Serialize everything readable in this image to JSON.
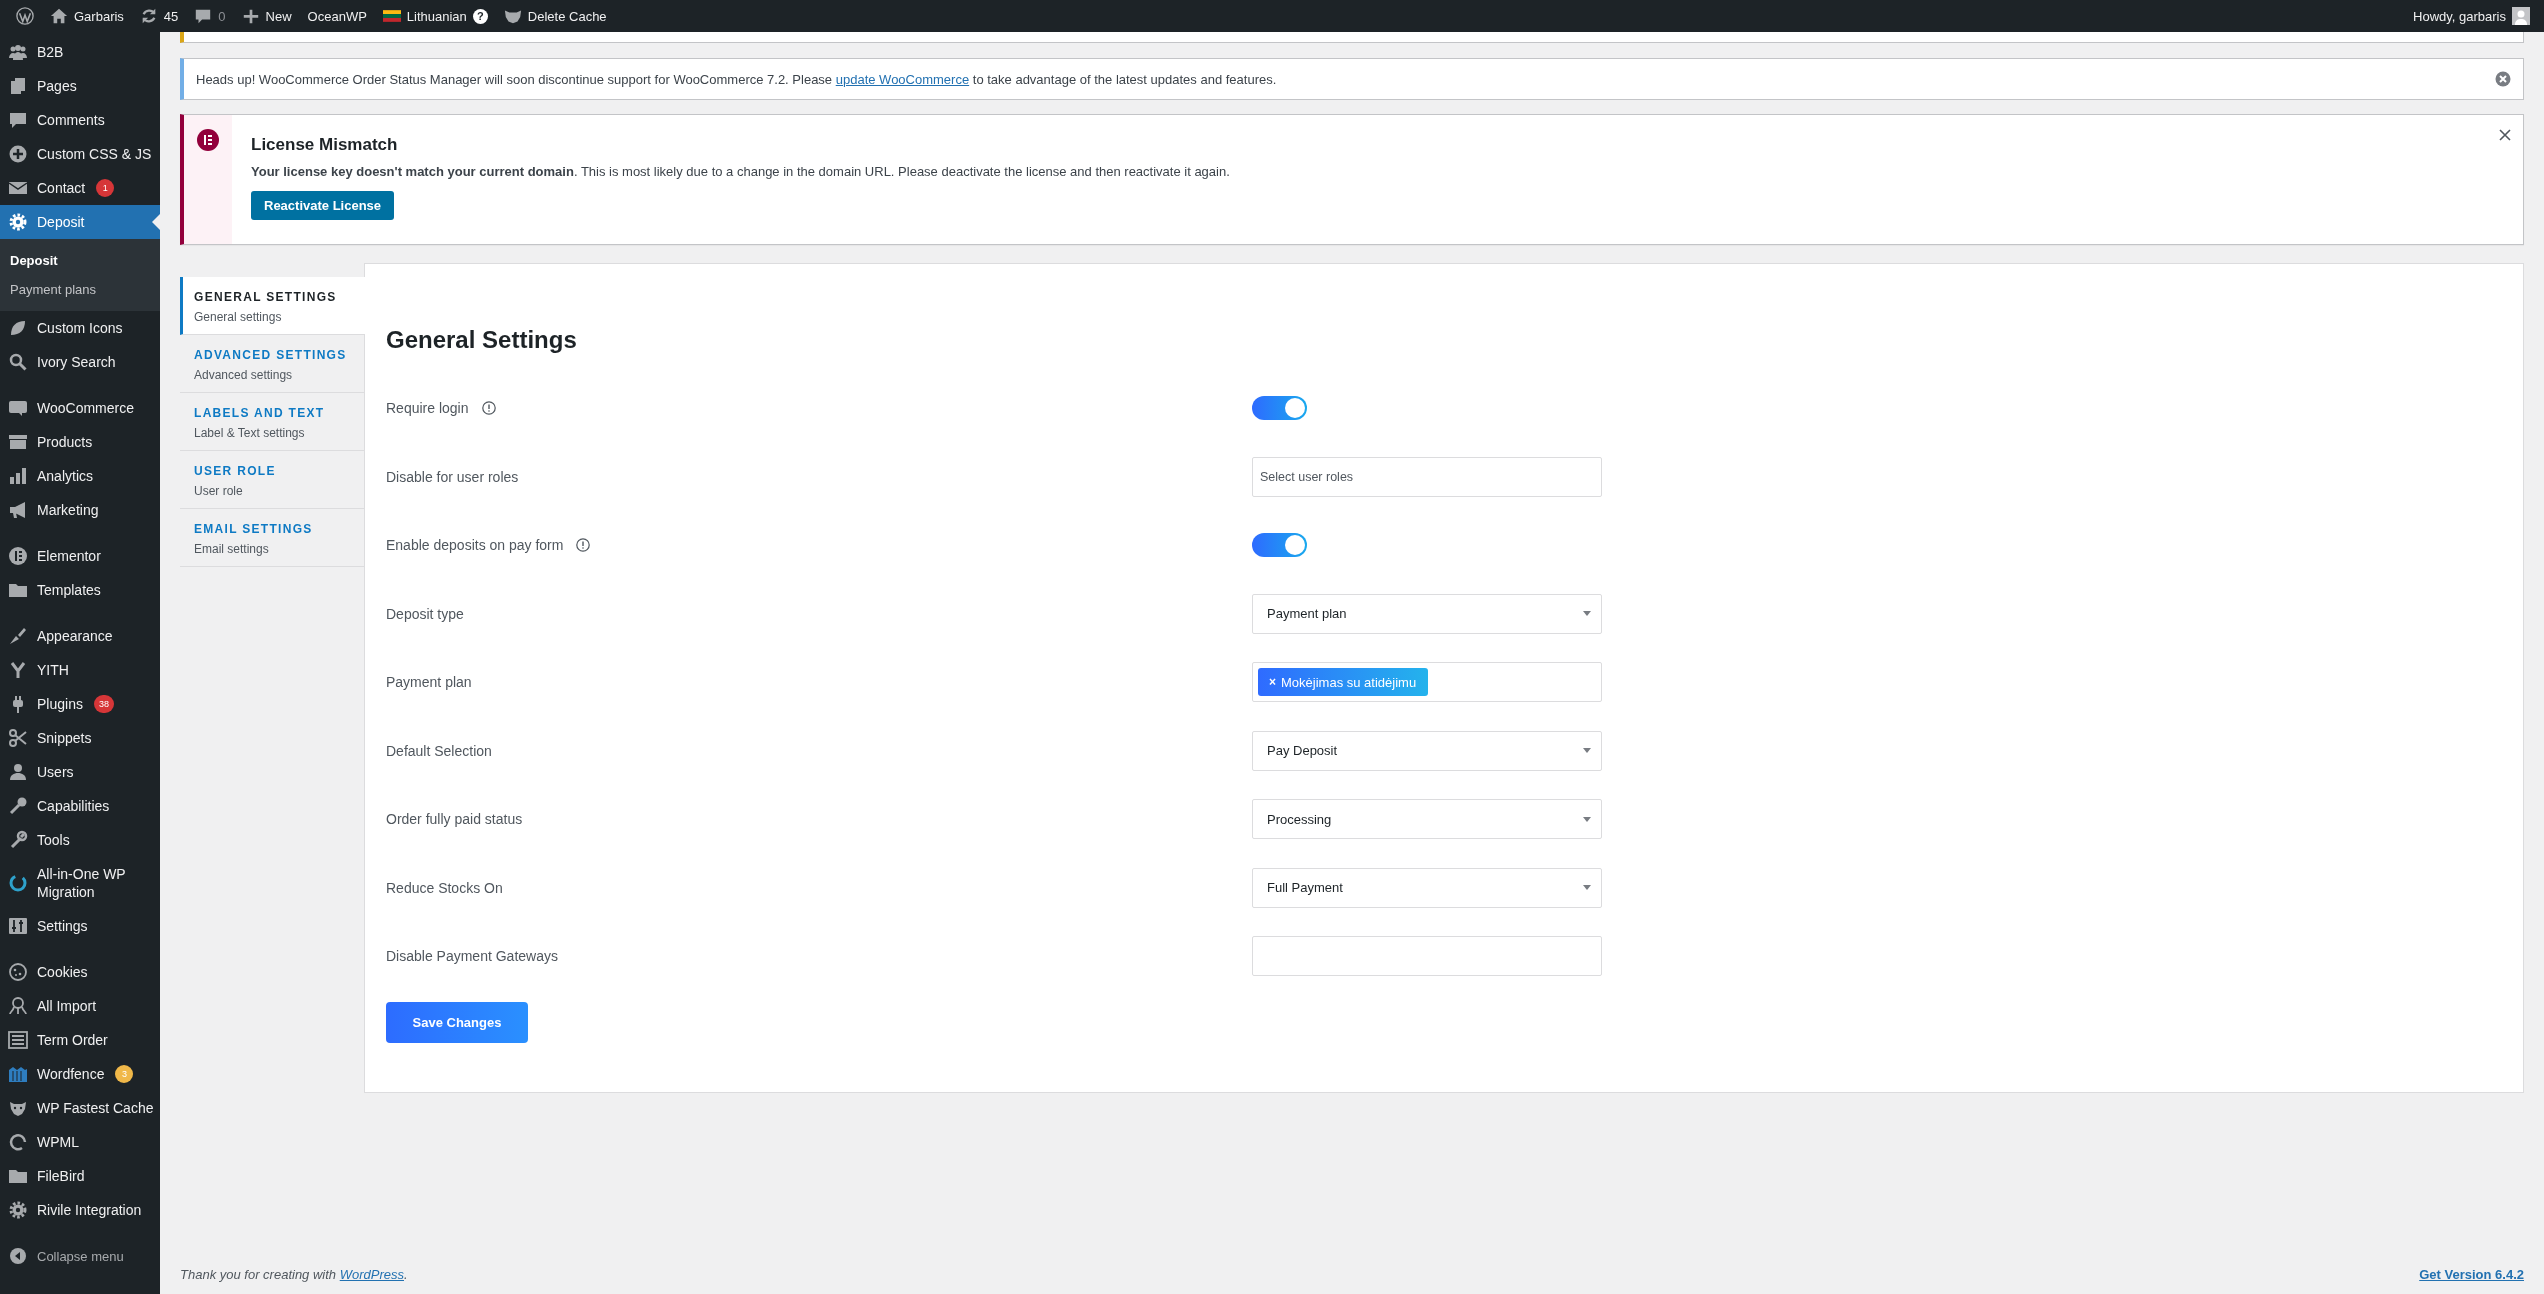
{
  "admin_bar": {
    "site": "Garbaris",
    "updates": "45",
    "comments": "0",
    "new": "New",
    "theme": "OceanWP",
    "language": "Lithuanian",
    "language_help": "?",
    "cache": "Delete Cache",
    "greeting": "Howdy, garbaris"
  },
  "sidebar": {
    "sections": [
      {
        "items": [
          {
            "label": "B2B",
            "selected": false
          },
          {
            "label": "Pages",
            "selected": false
          },
          {
            "label": "Comments",
            "selected": false
          },
          {
            "label": "Custom CSS & JS",
            "selected": false
          },
          {
            "label": "Contact",
            "selected": false,
            "badge": {
              "text": "1",
              "color": "#d63638"
            }
          },
          {
            "label": "Deposit",
            "selected": true,
            "submenu": [
              {
                "label": "Deposit",
                "selected": true
              },
              {
                "label": "Payment plans",
                "selected": false
              }
            ]
          },
          {
            "label": "Custom Icons",
            "selected": false
          },
          {
            "label": "Ivory Search",
            "selected": false
          }
        ]
      },
      {
        "items": [
          {
            "label": "WooCommerce",
            "selected": false
          },
          {
            "label": "Products",
            "selected": false
          },
          {
            "label": "Analytics",
            "selected": false
          },
          {
            "label": "Marketing",
            "selected": false
          }
        ]
      },
      {
        "items": [
          {
            "label": "Elementor",
            "selected": false
          },
          {
            "label": "Templates",
            "selected": false
          }
        ]
      },
      {
        "items": [
          {
            "label": "Appearance",
            "selected": false
          },
          {
            "label": "YITH",
            "selected": false
          },
          {
            "label": "Plugins",
            "selected": false,
            "badge": {
              "text": "38",
              "color": "#d63638"
            }
          },
          {
            "label": "Snippets",
            "selected": false
          },
          {
            "label": "Users",
            "selected": false
          },
          {
            "label": "Capabilities",
            "selected": false
          },
          {
            "label": "Tools",
            "selected": false
          },
          {
            "label": "All-in-One WP Migration",
            "selected": false
          },
          {
            "label": "Settings",
            "selected": false
          }
        ]
      },
      {
        "items": [
          {
            "label": "Cookies",
            "selected": false
          },
          {
            "label": "All Import",
            "selected": false
          },
          {
            "label": "Term Order",
            "selected": false
          },
          {
            "label": "Wordfence",
            "selected": false,
            "badge": {
              "text": "3",
              "color": "#f0b849"
            }
          },
          {
            "label": "WP Fastest Cache",
            "selected": false
          },
          {
            "label": "WPML",
            "selected": false
          },
          {
            "label": "FileBird",
            "selected": false
          },
          {
            "label": "Rivile Integration",
            "selected": false
          }
        ]
      }
    ],
    "collapse": "Collapse menu"
  },
  "notices": [
    {
      "kind": "info",
      "text_before": "Heads up! WooCommerce Order Status Manager will soon discontinue support for WooCommerce 7.2. Please ",
      "link": "update WooCommerce",
      "text_after": " to take advantage of the latest updates and features."
    },
    {
      "kind": "license",
      "title": "License Mismatch",
      "text": "**Your license key doesn't match your current domain**. This is most likely due to a change in the domain URL. Please deactivate the license and then reactivate it again.",
      "button": "Reactivate License"
    }
  ],
  "settings": {
    "tabs": [
      {
        "title": "GENERAL SETTINGS",
        "subtitle": "General settings",
        "selected": true
      },
      {
        "title": "ADVANCED SETTINGS",
        "subtitle": "Advanced settings",
        "selected": false
      },
      {
        "title": "LABELS AND TEXT",
        "subtitle": "Label & Text settings",
        "selected": false
      },
      {
        "title": "USER ROLE",
        "subtitle": "User role",
        "selected": false
      },
      {
        "title": "EMAIL SETTINGS",
        "subtitle": "Email settings",
        "selected": false
      }
    ],
    "heading": "General Settings",
    "fields": [
      {
        "label": "Require login",
        "help": true,
        "kind": "toggle",
        "on": true
      },
      {
        "label": "Disable for user roles",
        "help": false,
        "kind": "multiselect",
        "placeholder": "Select user roles"
      },
      {
        "label": "Enable deposits on pay form",
        "help": true,
        "kind": "toggle",
        "on": true
      },
      {
        "label": "Deposit type",
        "help": false,
        "kind": "select",
        "value": "Payment plan"
      },
      {
        "label": "Payment plan",
        "help": false,
        "kind": "tags",
        "tags": [
          {
            "remove": "×",
            "label": "Mokėjimas su atidėjimu"
          }
        ]
      },
      {
        "label": "Default Selection",
        "help": false,
        "kind": "select",
        "value": "Pay Deposit"
      },
      {
        "label": "Order fully paid status",
        "help": false,
        "kind": "select",
        "value": "Processing"
      },
      {
        "label": "Reduce Stocks On",
        "help": false,
        "kind": "select",
        "value": "Full Payment"
      },
      {
        "label": "Disable Payment Gateways",
        "help": false,
        "kind": "multiselect"
      }
    ],
    "save": "Save Changes"
  },
  "footer": {
    "text_before": "Thank you for creating with ",
    "link": "WordPress",
    "text_after": ".",
    "version": "Get Version 6.4.2"
  }
}
